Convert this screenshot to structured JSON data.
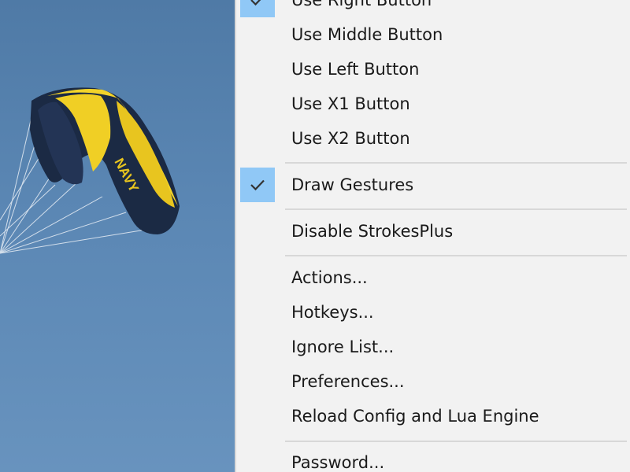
{
  "menu": {
    "items": [
      {
        "label": "Use Right Button",
        "checked": true
      },
      {
        "label": "Use Middle Button",
        "checked": false
      },
      {
        "label": "Use Left Button",
        "checked": false
      },
      {
        "label": "Use X1 Button",
        "checked": false
      },
      {
        "label": "Use X2 Button",
        "checked": false
      },
      {
        "label": "Draw Gestures",
        "checked": true
      },
      {
        "label": "Disable StrokesPlus",
        "checked": false
      },
      {
        "label": "Actions...",
        "checked": false
      },
      {
        "label": "Hotkeys...",
        "checked": false
      },
      {
        "label": "Ignore List...",
        "checked": false
      },
      {
        "label": "Preferences...",
        "checked": false
      },
      {
        "label": "Reload Config and Lua Engine",
        "checked": false
      },
      {
        "label": "Password...",
        "checked": false
      }
    ]
  },
  "desktop": {
    "parachute_text": "NAVY"
  },
  "colors": {
    "menu_bg": "#f2f2f2",
    "check_highlight": "#90c8f6",
    "separator": "#d8d8d8",
    "sky": "#5a86b3",
    "canopy_yellow": "#f2d32a",
    "canopy_navy": "#1b2a44"
  }
}
